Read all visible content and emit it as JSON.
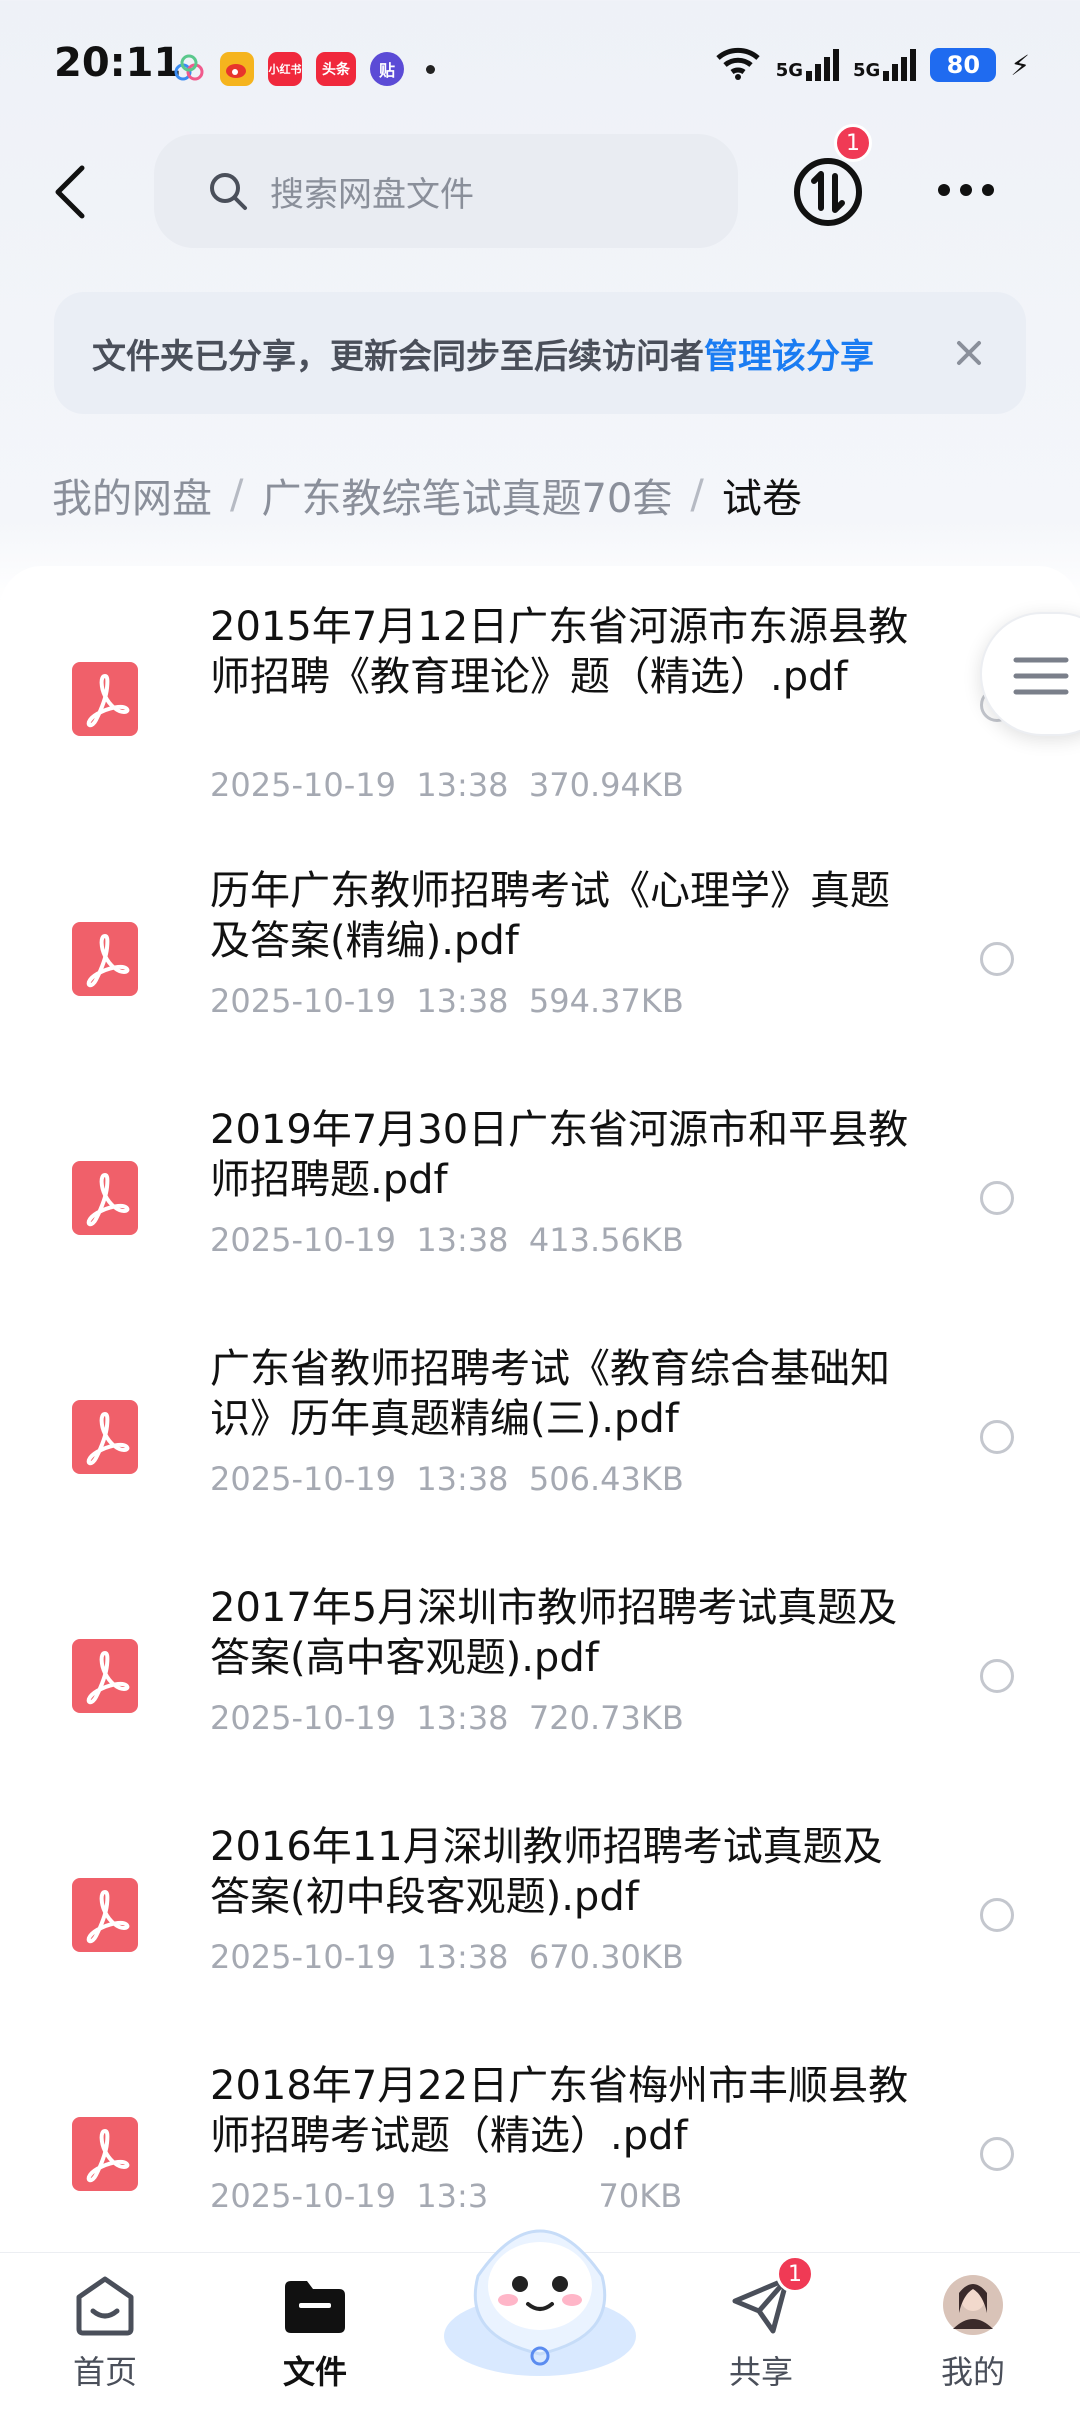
{
  "status_bar": {
    "time": "20:11",
    "apps": [
      {
        "name": "cloud-app-icon",
        "label": "",
        "color": "#ffffff"
      },
      {
        "name": "weibo-icon",
        "label": "",
        "color": "#f5b41e"
      },
      {
        "name": "xiaohongshu-icon",
        "label": "小红书",
        "color": "#f0283c"
      },
      {
        "name": "toutiao-icon",
        "label": "头条",
        "color": "#f0283c"
      },
      {
        "name": "tieba-icon",
        "label": "贴",
        "color": "#5b4bd6"
      }
    ],
    "signal1": "5G",
    "signal2": "5G",
    "battery": "80"
  },
  "top_bar": {
    "search_placeholder": "搜索网盘文件",
    "transfer_badge": "1"
  },
  "notice": {
    "text": "文件夹已分享，更新会同步至后续访问者",
    "link": "管理该分享"
  },
  "breadcrumb": {
    "items": [
      "我的网盘",
      "广东教综笔试真题70套",
      "试卷"
    ],
    "separator": "/"
  },
  "files": [
    {
      "name": "2015年7月12日广东省河源市东源县教师招聘《教育理论》题（精选）.pdf",
      "date": "2025-10-19",
      "time": "13:38",
      "size": "370.94KB"
    },
    {
      "name": "历年广东教师招聘考试《心理学》真题及答案(精编).pdf",
      "date": "2025-10-19",
      "time": "13:38",
      "size": "594.37KB"
    },
    {
      "name": "2019年7月30日广东省河源市和平县教师招聘题.pdf",
      "date": "2025-10-19",
      "time": "13:38",
      "size": "413.56KB"
    },
    {
      "name": "广东省教师招聘考试《教育综合基础知识》历年真题精编(三).pdf",
      "date": "2025-10-19",
      "time": "13:38",
      "size": "506.43KB"
    },
    {
      "name": "2017年5月深圳市教师招聘考试真题及答案(高中客观题).pdf",
      "date": "2025-10-19",
      "time": "13:38",
      "size": "720.73KB"
    },
    {
      "name": "2016年11月深圳教师招聘考试真题及答案(初中段客观题).pdf",
      "date": "2025-10-19",
      "time": "13:38",
      "size": "670.30KB"
    },
    {
      "name": "2018年7月22日广东省梅州市丰顺县教师招聘考试题（精选）.pdf",
      "date": "2025-10-19",
      "time": "13:3",
      "size": "70KB"
    }
  ],
  "bottom_nav": {
    "items": [
      {
        "label": "首页",
        "active": false
      },
      {
        "label": "文件",
        "active": true
      },
      {
        "label": "共享",
        "active": false,
        "badge": "1"
      },
      {
        "label": "我的",
        "active": false
      }
    ]
  },
  "colors": {
    "accent": "#1a7cf2",
    "pdf_red": "#f0606a",
    "badge_red": "#f03a55",
    "battery_blue": "#1f6bf0"
  }
}
